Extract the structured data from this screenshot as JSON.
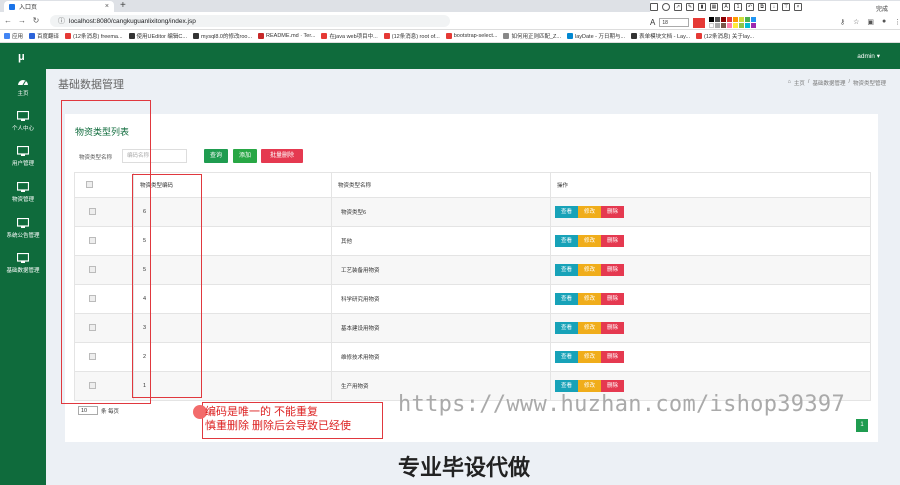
{
  "browser": {
    "tab_title": "入口页",
    "url": "localhost:8080/cangkuguanlixitong/index.jsp",
    "drawtools_done": "完成",
    "font_size": "18",
    "bookmarks": [
      {
        "label": "应用",
        "color": "#4285f4"
      },
      {
        "label": "百度翻译",
        "color": "#2b63d9"
      },
      {
        "label": "(12条消息) freema...",
        "color": "#e53935"
      },
      {
        "label": "使用UEditor 编辑C...",
        "color": "#333333"
      },
      {
        "label": "mysql8.0的修改roo...",
        "color": "#333333"
      },
      {
        "label": "README.md · Ter...",
        "color": "#c62828"
      },
      {
        "label": "在java web项目中...",
        "color": "#e53935"
      },
      {
        "label": "(12条消息) root of...",
        "color": "#e53935"
      },
      {
        "label": "bootstrap-select...",
        "color": "#e53935"
      },
      {
        "label": "如何用正则匹配_Z...",
        "color": "#888888"
      },
      {
        "label": "layDate - 万日期与...",
        "color": "#0288d1"
      },
      {
        "label": "表单模块文档 - Lay...",
        "color": "#333333"
      },
      {
        "label": "(12条消息) 关于lay...",
        "color": "#e53935"
      }
    ]
  },
  "app": {
    "logo": "μ",
    "user": "admin ▾",
    "sidebar": [
      {
        "label": "主页",
        "icon": "dashboard-icon"
      },
      {
        "label": "个人中心",
        "icon": "monitor-icon"
      },
      {
        "label": "用户管理",
        "icon": "monitor-icon"
      },
      {
        "label": "物资管理",
        "icon": "monitor-icon"
      },
      {
        "label": "系统公告管理",
        "icon": "monitor-icon"
      },
      {
        "label": "基础数据管理",
        "icon": "monitor-icon"
      }
    ],
    "page_title": "基础数据管理",
    "breadcrumb": [
      "主页",
      "/",
      "基础数据管理",
      "/",
      "物资类型管理"
    ],
    "card_title": "物资类型列表",
    "filter_label": "物资类型名称",
    "filter_placeholder": "编码名称",
    "btn_query": "查询",
    "btn_add": "添加",
    "btn_batch_delete": "批量删除",
    "columns": [
      "物资类型编码",
      "物资类型名称",
      "操作"
    ],
    "rows": [
      {
        "code": "6",
        "name": "物资类型6"
      },
      {
        "code": "5",
        "name": "其他"
      },
      {
        "code": "5",
        "name": "工艺装备用物资"
      },
      {
        "code": "4",
        "name": "科学研究用物资"
      },
      {
        "code": "3",
        "name": "基本建设用物资"
      },
      {
        "code": "2",
        "name": "维修技术用物资"
      },
      {
        "code": "1",
        "name": "生产用物资"
      }
    ],
    "op_view": "查看",
    "op_edit": "修改",
    "op_delete": "删除",
    "page_size": "10",
    "page_size_suffix": "条 每页",
    "current_page": "1"
  },
  "annotation": {
    "line1": "编码是唯一的 不能重复",
    "line2": "慎重删除 删除后会导致已经使",
    "watermark": "https://www.huzhan.com/ishop39397",
    "banner": "专业毕设代做"
  },
  "colors": {
    "brand": "#0f6b3c",
    "query": "#1f9c50",
    "danger": "#e53950",
    "info": "#17a2b8",
    "warning": "#f0ad1b"
  }
}
